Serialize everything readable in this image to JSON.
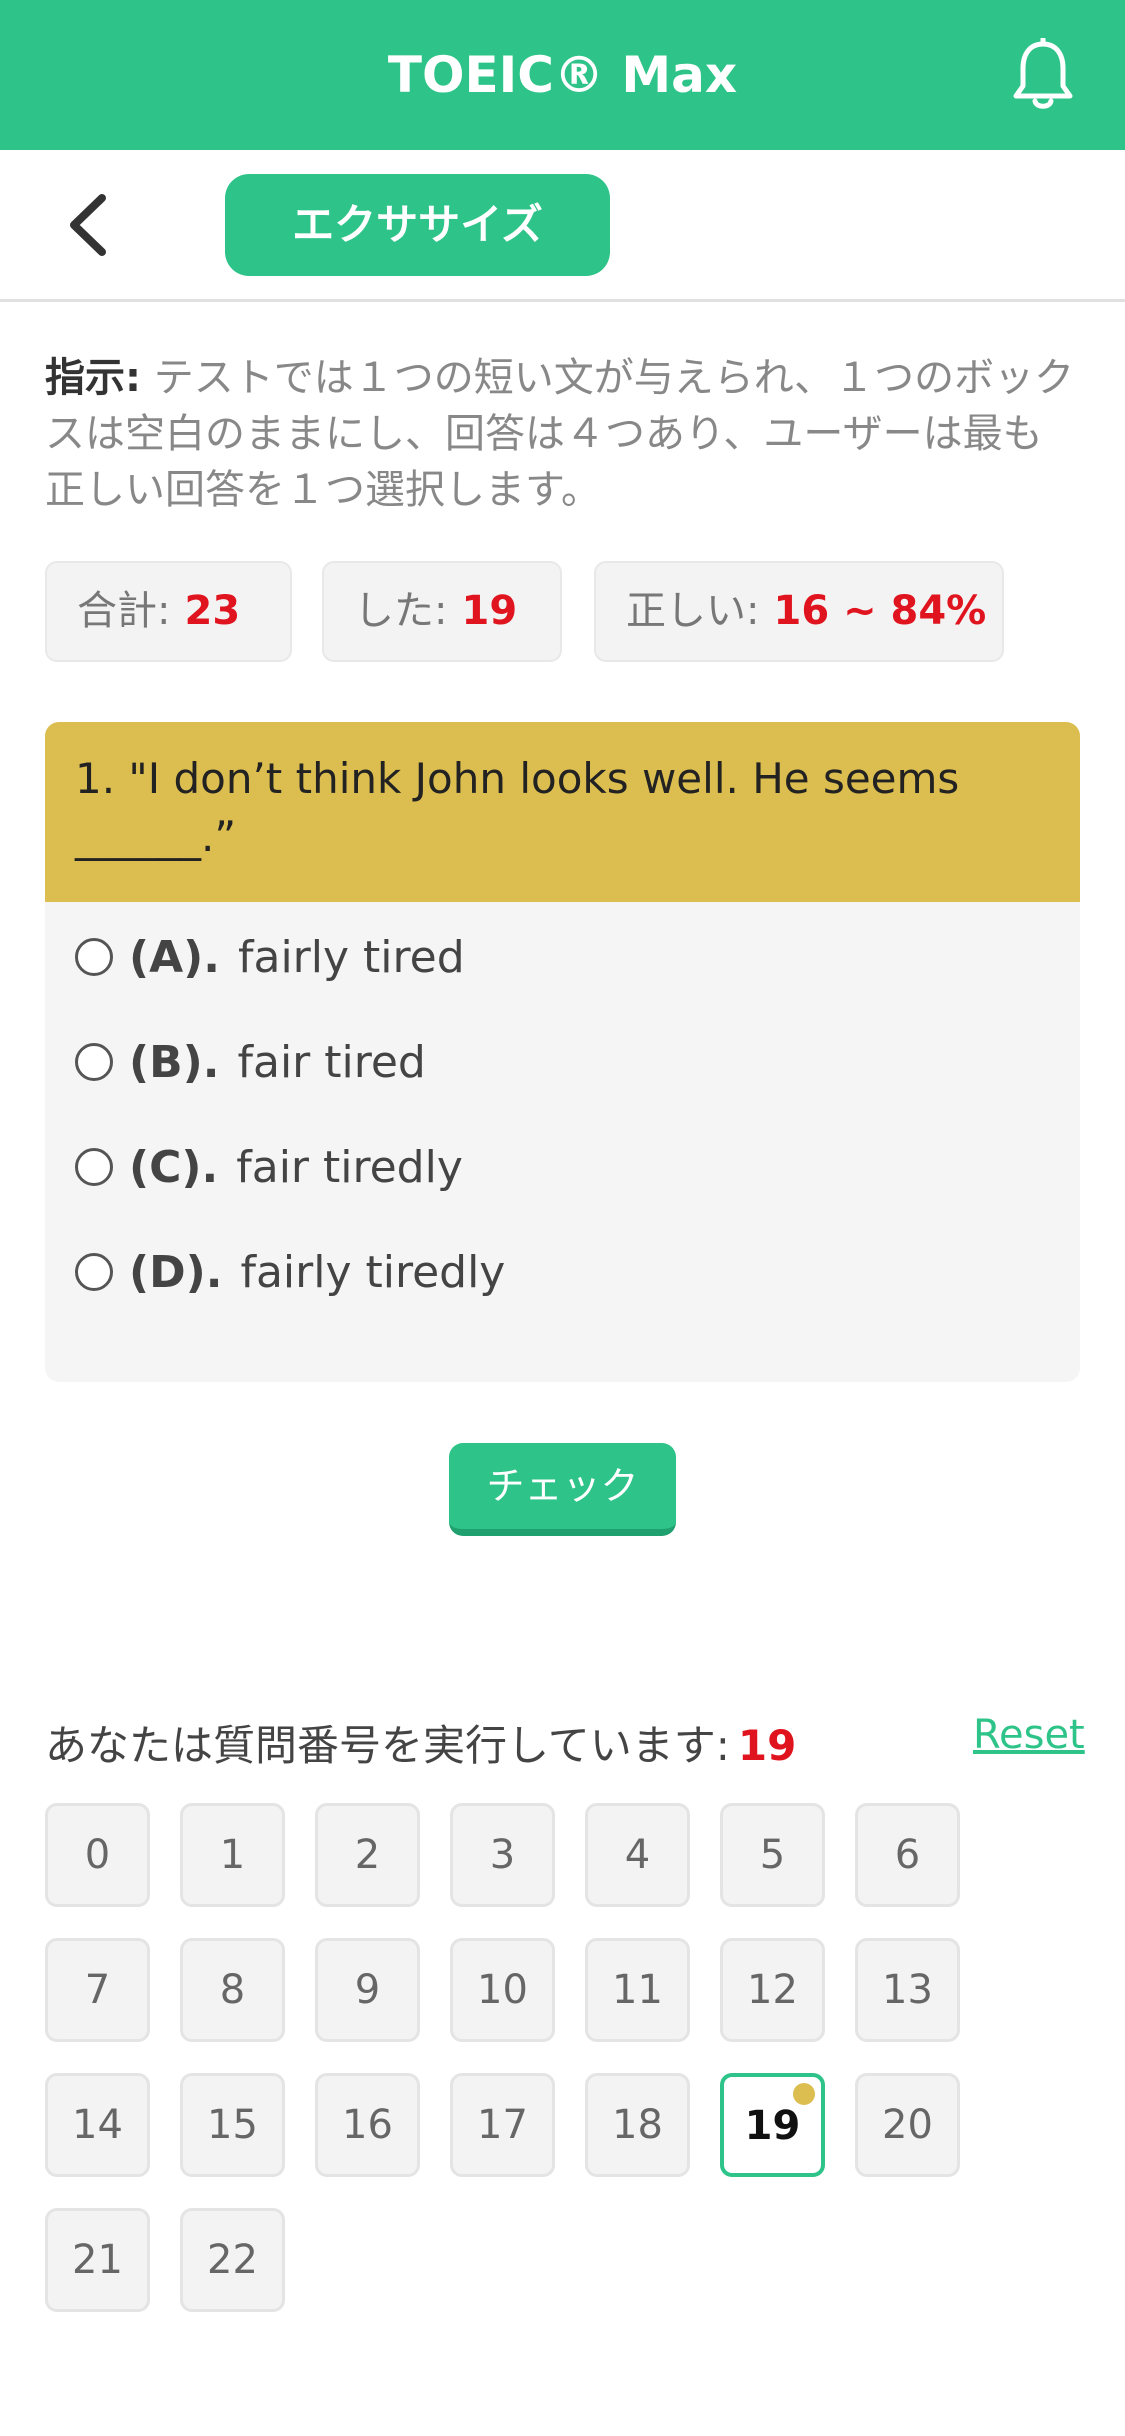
{
  "header": {
    "title": "TOEIC® Max",
    "bell_icon": "bell-icon"
  },
  "subheader": {
    "back_icon": "chevron-left-icon",
    "tab_label": "エクササイズ"
  },
  "instruction": {
    "label": "指示:",
    "text": " テストでは１つの短い文が与えられ、１つのボックスは空白のままにし、回答は４つあり、ユーザーは最も正しい回答を１つ選択します。"
  },
  "stats": {
    "total_label": "合計:",
    "total_value": "23",
    "done_label": "した:",
    "done_value": "19",
    "correct_label": "正しい:",
    "correct_value": "16 ~ 84%"
  },
  "question": {
    "text": "1. \"I don’t think John looks well. He seems ______.”",
    "options": [
      {
        "key": "(A).",
        "text": "fairly tired"
      },
      {
        "key": "(B).",
        "text": "fair tired"
      },
      {
        "key": "(C).",
        "text": "fair tiredly"
      },
      {
        "key": "(D).",
        "text": "fairly tiredly"
      }
    ]
  },
  "check_button": "チェック",
  "progress": {
    "label": "あなたは質問番号を実行しています:",
    "current": "19",
    "reset": "Reset"
  },
  "question_numbers": [
    "0",
    "1",
    "2",
    "3",
    "4",
    "5",
    "6",
    "7",
    "8",
    "9",
    "10",
    "11",
    "12",
    "13",
    "14",
    "15",
    "16",
    "17",
    "18",
    "19",
    "20",
    "21",
    "22"
  ],
  "active_question": "19",
  "colors": {
    "accent": "#2ec489",
    "question_header": "#dcbe50",
    "highlight_red": "#e0141e"
  }
}
